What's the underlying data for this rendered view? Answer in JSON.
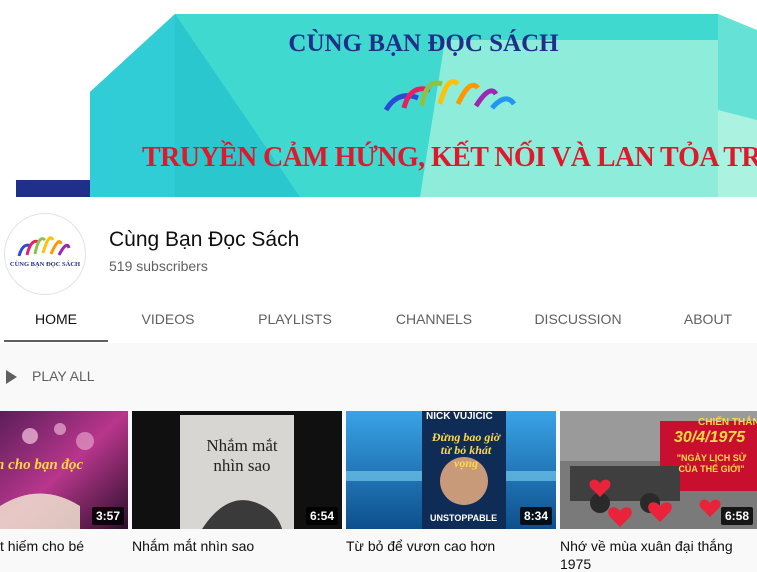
{
  "banner": {
    "title": "CÙNG BẠN ĐỌC SÁCH",
    "slogan": "TRUYỀN CẢM HỨNG, KẾT NỐI VÀ LAN TỎA TRI THỨC"
  },
  "channel": {
    "name": "Cùng Bạn Đọc Sách",
    "subscribers": "519 subscribers",
    "avatar_text": "CÙNG BẠN ĐỌC SÁCH"
  },
  "tabs": [
    {
      "label": "HOME",
      "active": true
    },
    {
      "label": "VIDEOS"
    },
    {
      "label": "PLAYLISTS"
    },
    {
      "label": "CHANNELS"
    },
    {
      "label": "DISCUSSION"
    },
    {
      "label": "ABOUT"
    }
  ],
  "play_all": "PLAY ALL",
  "videos": [
    {
      "title": "t hiếm cho bé",
      "title2": "",
      "duration": "3:57",
      "thumb_text": "h cho bạn đọc"
    },
    {
      "title": "Nhắm mắt nhìn sao",
      "title2": "",
      "duration": "6:54",
      "thumb_text": "Nhắm mắt nhìn sao"
    },
    {
      "title": "Từ bỏ để vươn cao hơn",
      "title2": "",
      "duration": "8:34",
      "thumb_text_top": "NICK VUJICIC",
      "thumb_text": "Đừng bao giờ từ bỏ khát vọng",
      "thumb_text_bottom": "UNSTOPPABLE"
    },
    {
      "title": "Nhớ về mùa xuân đại thắng",
      "title2": "1975",
      "duration": "6:58",
      "thumb_text_top": "CHIẾN THẮNG",
      "thumb_text": "30/4/1975",
      "thumb_text_bottom": "\"NGÀY LỊCH SỬ CỦA THẾ GIỚI\""
    }
  ],
  "colors": {
    "banner_teal": "#3fd9d0",
    "banner_navy": "#1f2f8a",
    "banner_red": "#e0182b",
    "text_secondary": "#606060"
  }
}
